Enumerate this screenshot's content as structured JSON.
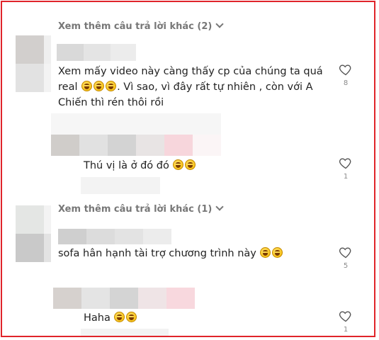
{
  "thread": {
    "more_1": "Xem thêm câu trả lời khác (2)",
    "more_2": "Xem thêm câu trả lời khác (1)"
  },
  "comments": [
    {
      "text_line1": "Xem mấy video này càng thấy cp của chúng ta quá",
      "text_line2_a": "real",
      "text_line2_b": ". Vì sao, vì đây rất tự nhiên , còn với A",
      "text_line3": "Chiến thì rén thôi rồi",
      "likes": "8"
    },
    {
      "text": "Thú vị là ở đó đó",
      "likes": "1"
    },
    {
      "text": "sofa hân hạnh tài trợ chương trình này",
      "likes": "5"
    },
    {
      "text": "Haha",
      "likes": "1"
    }
  ],
  "icons": {
    "like": "heart-icon",
    "expand": "chevron-down-icon",
    "emoji": "grinning-face-emoji"
  },
  "colors": {
    "border": "#e0242a",
    "muted": "#777777",
    "redaction": "#d6d6d6"
  }
}
